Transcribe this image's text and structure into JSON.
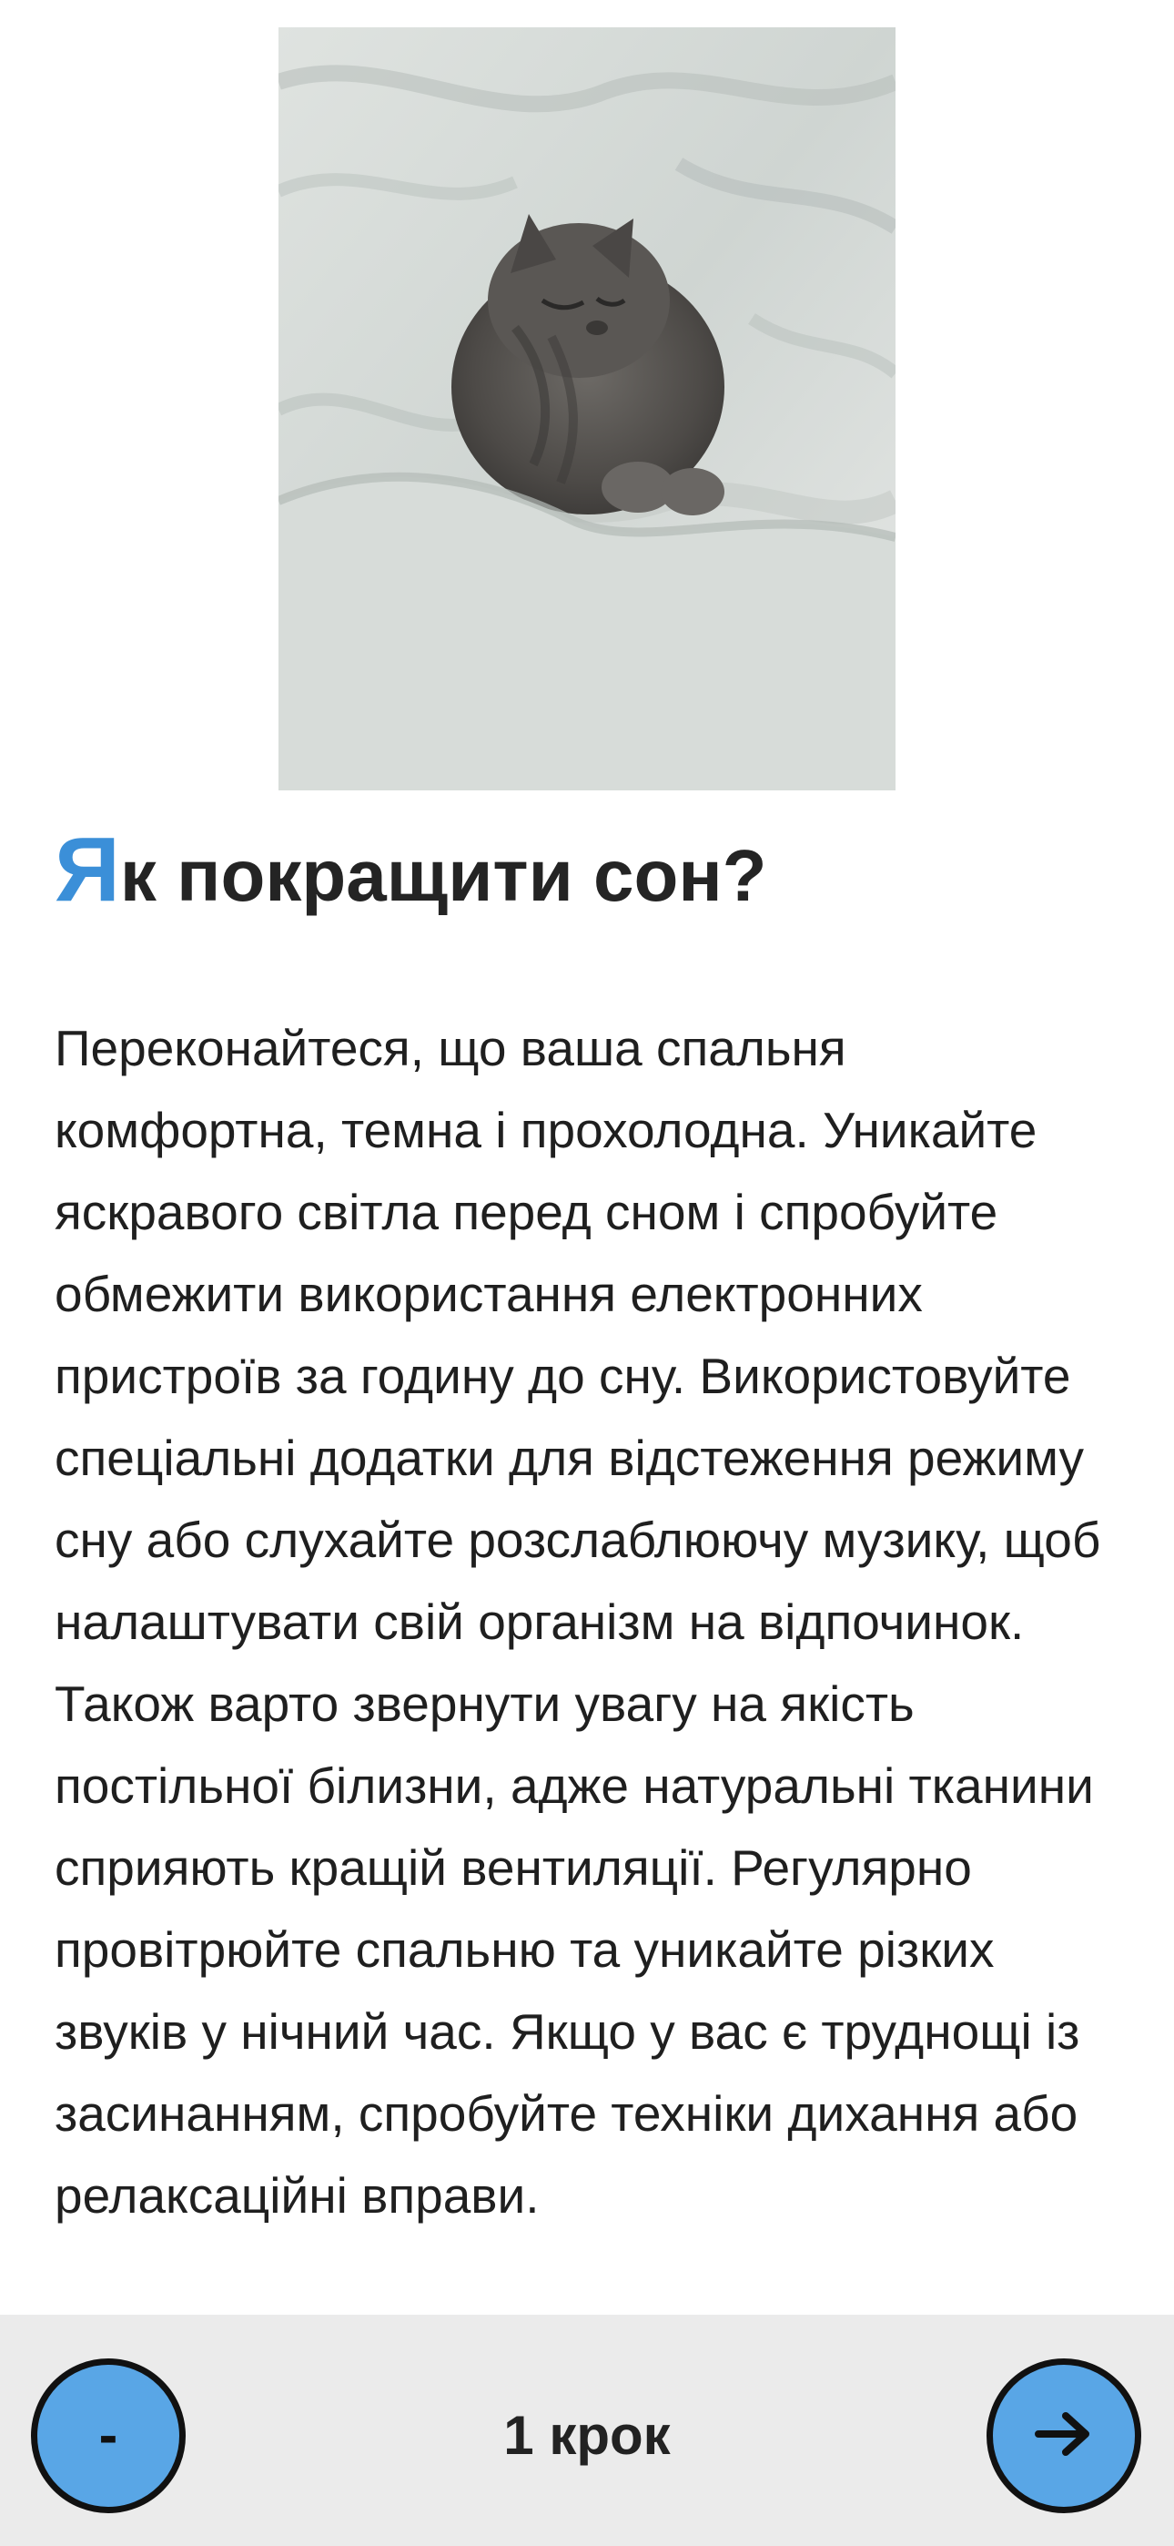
{
  "hero": {
    "image": "sleeping-kitten-in-white-bedding"
  },
  "article": {
    "title_first_letter": "Я",
    "title_rest": "к покращити сон?",
    "body": "Переконайтеся, що ваша спальня комфортна, темна і прохолодна. Уникайте яскравого світла перед сном і спробуйте обмежити використання електронних пристроїв за годину до сну. Використовуйте спеціальні додатки для відстеження режиму сну або слухайте розслаблюючу музику, щоб налаштувати свій організм на відпочинок. Також варто звернути увагу на якість постільної білизни, адже натуральні тканини сприяють кращій вентиляції. Регулярно провітрюйте спальню та уникайте різких звуків у нічний час. Якщо у вас є труднощі із засинанням, спробуйте техніки дихання або релаксаційні вправи."
  },
  "footer": {
    "prev_label": "-",
    "step_label": "1 крок",
    "next_icon": "arrow-right-icon"
  },
  "colors": {
    "accent": "#3b8fd8",
    "button_fill": "#59a6e6",
    "footer_bg": "#ebebeb"
  }
}
